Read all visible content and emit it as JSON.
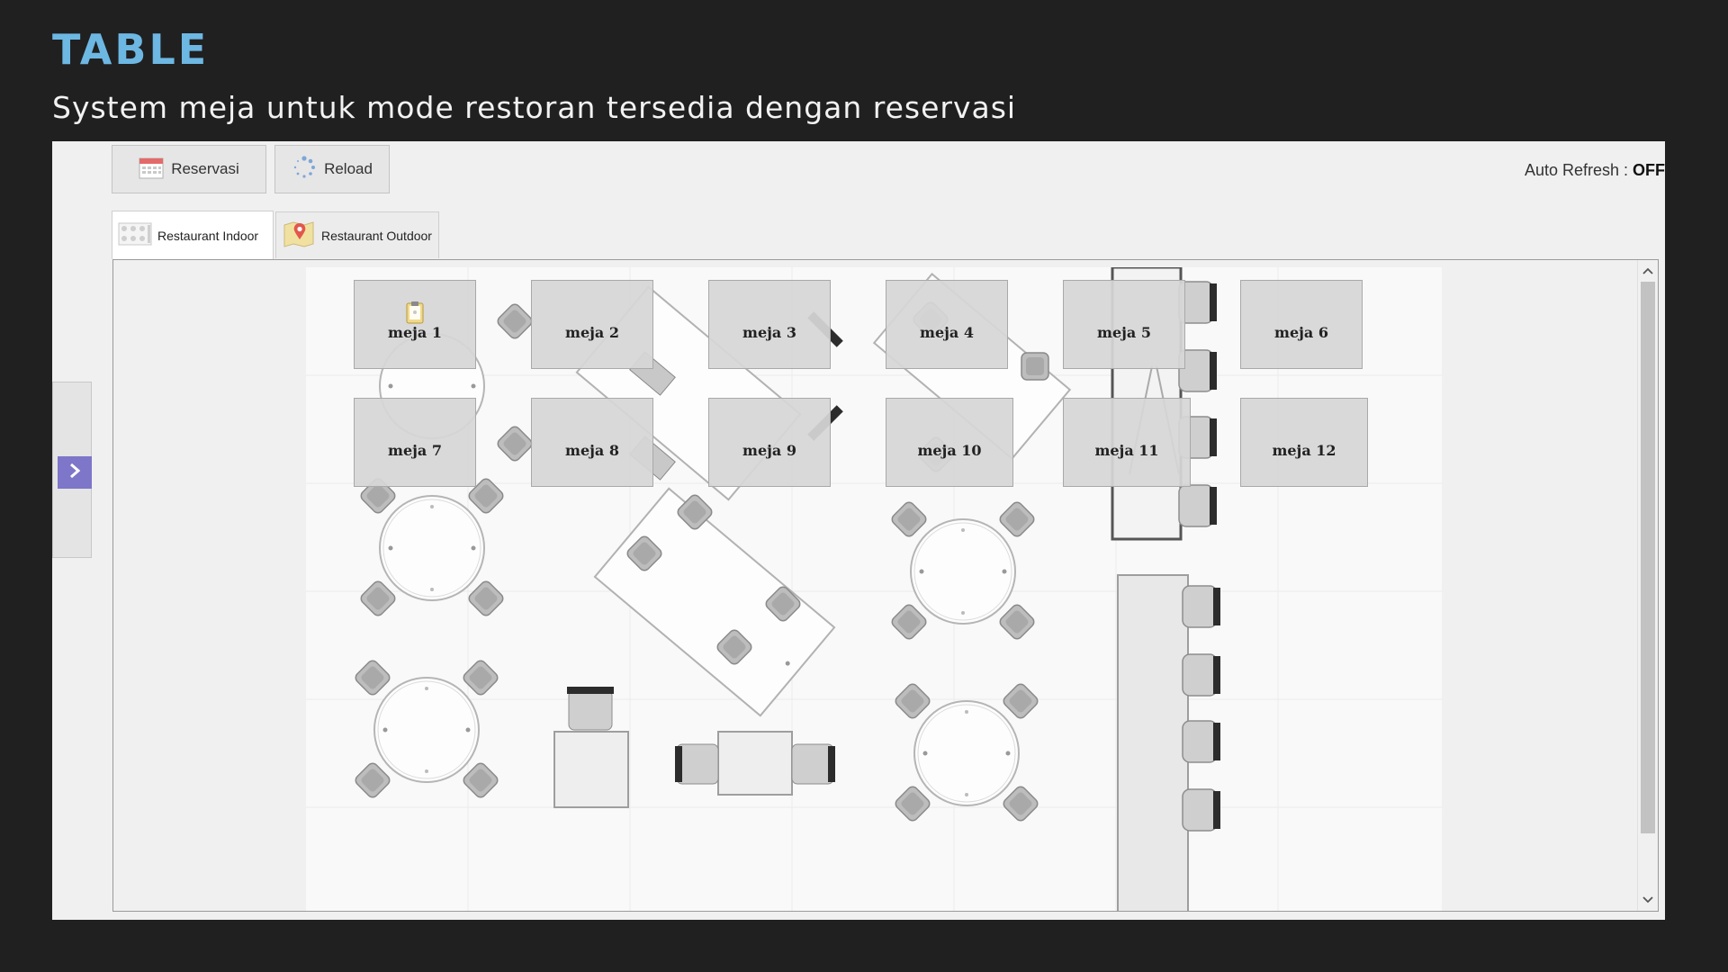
{
  "header": {
    "title": "TABLE",
    "subtitle": "System meja untuk mode restoran tersedia dengan reservasi"
  },
  "toolbar": {
    "reservasi_label": "Reservasi",
    "reload_label": "Reload",
    "auto_refresh_label": "Auto Refresh : ",
    "auto_refresh_value": "OFF"
  },
  "tabs": [
    {
      "label": "Restaurant Indoor",
      "icon": "floorplan-icon",
      "active": true
    },
    {
      "label": "Restaurant Outdoor",
      "icon": "map-pin-icon",
      "active": false
    }
  ],
  "tables": [
    {
      "label": "meja 1",
      "reserved_icon": true
    },
    {
      "label": "meja 2"
    },
    {
      "label": "meja 3"
    },
    {
      "label": "meja 4"
    },
    {
      "label": "meja 5"
    },
    {
      "label": "meja 6"
    },
    {
      "label": "meja 7"
    },
    {
      "label": "meja 8"
    },
    {
      "label": "meja 9"
    },
    {
      "label": "meja 10"
    },
    {
      "label": "meja 11"
    },
    {
      "label": "meja 12"
    }
  ],
  "colors": {
    "accent_title": "#6db7e3",
    "background": "#202020",
    "side_arrow": "#7d76c9"
  }
}
